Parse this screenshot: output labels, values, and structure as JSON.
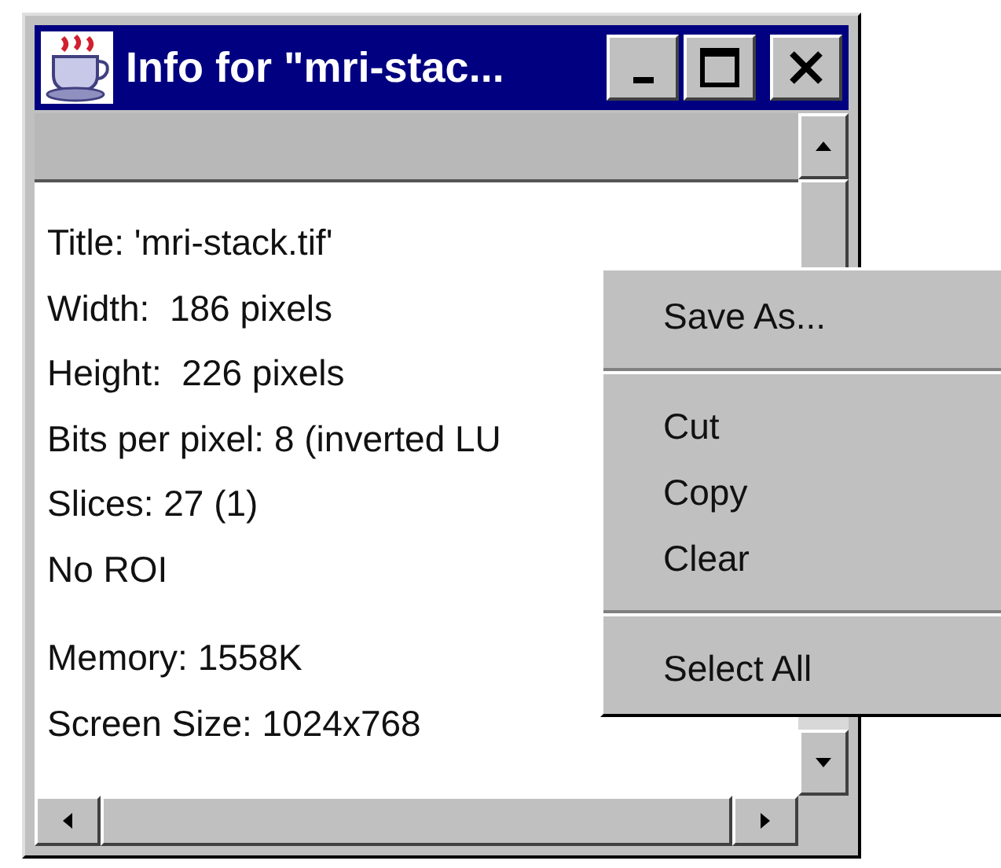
{
  "window": {
    "title": "Info for \"mri-stac..."
  },
  "title_buttons": [
    {
      "kind": "minimize"
    },
    {
      "kind": "maximize"
    },
    {
      "kind": "close"
    }
  ],
  "info_sections": [
    [
      "Title: 'mri-stack.tif'",
      "Width:  186 pixels",
      "Height:  226 pixels",
      "Bits per pixel: 8 (inverted LU",
      "Slices: 27 (1)",
      "No ROI"
    ],
    [
      "Memory: 1558K",
      "Screen Size: 1024x768"
    ]
  ],
  "context_menu": [
    {
      "kind": "item",
      "label": "Save As..."
    },
    {
      "kind": "separator"
    },
    {
      "kind": "item",
      "label": "Cut"
    },
    {
      "kind": "item",
      "label": "Copy"
    },
    {
      "kind": "item",
      "label": "Clear"
    },
    {
      "kind": "separator"
    },
    {
      "kind": "item",
      "label": "Select All"
    }
  ]
}
